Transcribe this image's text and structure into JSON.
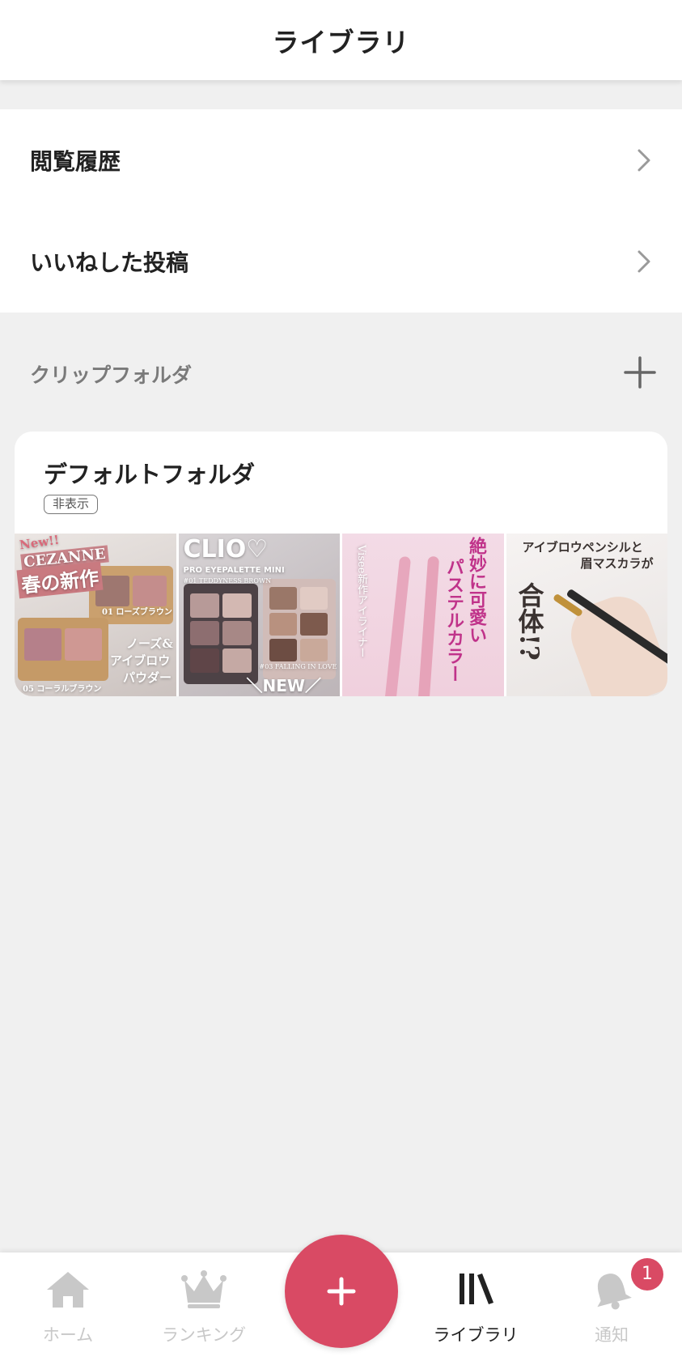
{
  "header": {
    "title": "ライブラリ"
  },
  "menu": {
    "items": [
      {
        "label": "閲覧履歴"
      },
      {
        "label": "いいねした投稿"
      }
    ]
  },
  "clip_section": {
    "label": "クリップフォルダ"
  },
  "folder": {
    "name": "デフォルトフォルダ",
    "badge": "非表示",
    "thumbnails": [
      {
        "lines": [
          "New!!",
          "CEZANNE",
          "春の新作",
          "01 ローズブラウン",
          "ノーズ&",
          "アイブロウ",
          "パウダー",
          "05 コーラルブラウン"
        ]
      },
      {
        "lines": [
          "CLIO♡",
          "PRO EYEPALETTE MINI",
          "#01 TEDDYNESS BROWN",
          "#03 FALLING IN LOVE",
          "＼NEW／"
        ]
      },
      {
        "lines": [
          "絶妙に可愛い",
          "パステルカラー",
          "Visee新作アイライナー"
        ]
      },
      {
        "lines": [
          "アイブロウペンシルと",
          "眉マスカラが",
          "合体!?"
        ]
      }
    ]
  },
  "tabbar": {
    "tabs": [
      {
        "label": "ホーム",
        "icon": "home-icon"
      },
      {
        "label": "ランキング",
        "icon": "crown-icon"
      },
      {
        "label": "ライブラリ",
        "icon": "library-icon"
      },
      {
        "label": "通知",
        "icon": "bell-icon"
      }
    ],
    "notification_count": "1"
  },
  "colors": {
    "accent": "#d94a64",
    "background": "#f0f0f0",
    "inactive_tab": "#c8c8c8"
  }
}
